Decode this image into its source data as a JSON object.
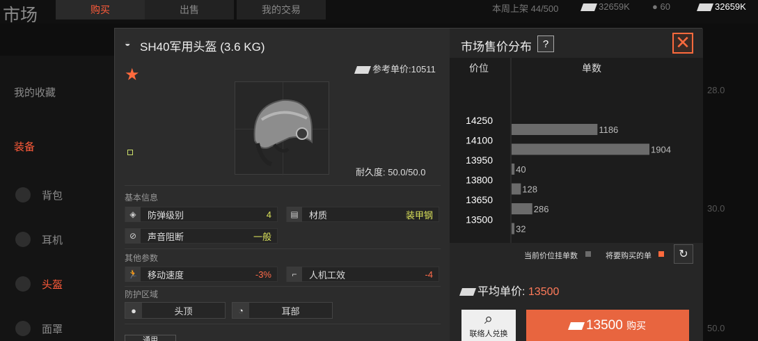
{
  "header": {
    "app_title": "市场",
    "tabs": [
      "购买",
      "出售",
      "我的交易"
    ],
    "week_listing": "本周上架 44/500",
    "currency_1": "32659K",
    "coins": "60",
    "currency_2": "32659K"
  },
  "sidebar": {
    "items": [
      {
        "label": "我的收藏",
        "icon": "chevron-right-icon"
      },
      {
        "label": "装备",
        "icon": "chevron-down-icon"
      },
      {
        "label": "背包",
        "icon": "backpack-icon"
      },
      {
        "label": "耳机",
        "icon": "headset-icon"
      },
      {
        "label": "头盔",
        "icon": "helmet-icon"
      },
      {
        "label": "面罩",
        "icon": "mask-icon"
      }
    ]
  },
  "bg_right": {
    "top_value": "28.0",
    "mid_value": "30.0",
    "bottom_value": "50.0"
  },
  "item": {
    "title": "SH40军用头盔 (3.6 KG)",
    "ref_price_label": "参考单价:10511",
    "durability": "耐久度: 50.0/50.0",
    "basic_info_label": "基本信息",
    "other_params_label": "其他参数",
    "protect_zone_label": "防护区域",
    "attrs": [
      {
        "label": "防弹级别",
        "value": "4",
        "icon": "shield-icon"
      },
      {
        "label": "材质",
        "value": "装甲钢",
        "icon": "material-icon"
      },
      {
        "label": "声音阻断",
        "value": "一般",
        "icon": "sound-block-icon"
      }
    ],
    "params": [
      {
        "label": "移动速度",
        "value": "-3%",
        "icon": "run-icon"
      },
      {
        "label": "人机工效",
        "value": "-4",
        "icon": "gun-icon"
      }
    ],
    "zones": [
      {
        "label": "头顶",
        "icon": "head-icon"
      },
      {
        "label": "耳部",
        "icon": "ear-icon"
      }
    ],
    "bottom_tab": "通用"
  },
  "market": {
    "title": "市场售价分布",
    "help": "?",
    "close": "✕",
    "col_price": "价位",
    "col_count": "单数",
    "legend_current": "当前价位挂单数",
    "legend_want": "将要购买的单",
    "avg_label": "平均单价:",
    "avg_value": "13500",
    "exchange_label": "联络人兑换",
    "buy_price": "13500",
    "buy_label": "购买",
    "colors": {
      "bar": "#6b6b6b",
      "accent": "#e8653f",
      "want": "#ff6a3d"
    }
  },
  "chart_data": {
    "type": "bar",
    "orientation": "horizontal",
    "price_ticks": [
      "14250",
      "14100",
      "13950",
      "13800",
      "13650",
      "13500"
    ],
    "bars": [
      {
        "price_between": [
          "14250",
          "14100"
        ],
        "value": 1186
      },
      {
        "price_between": [
          "14100",
          "13950"
        ],
        "value": 1904
      },
      {
        "price_between": [
          "13950",
          "13800"
        ],
        "value": 40
      },
      {
        "price_between": [
          "13800",
          "13650"
        ],
        "value": 128
      },
      {
        "price_between": [
          "13650",
          "13500"
        ],
        "value": 286
      },
      {
        "price_between": [
          "13500",
          ""
        ],
        "value": 32
      }
    ],
    "xmax": 1904
  }
}
